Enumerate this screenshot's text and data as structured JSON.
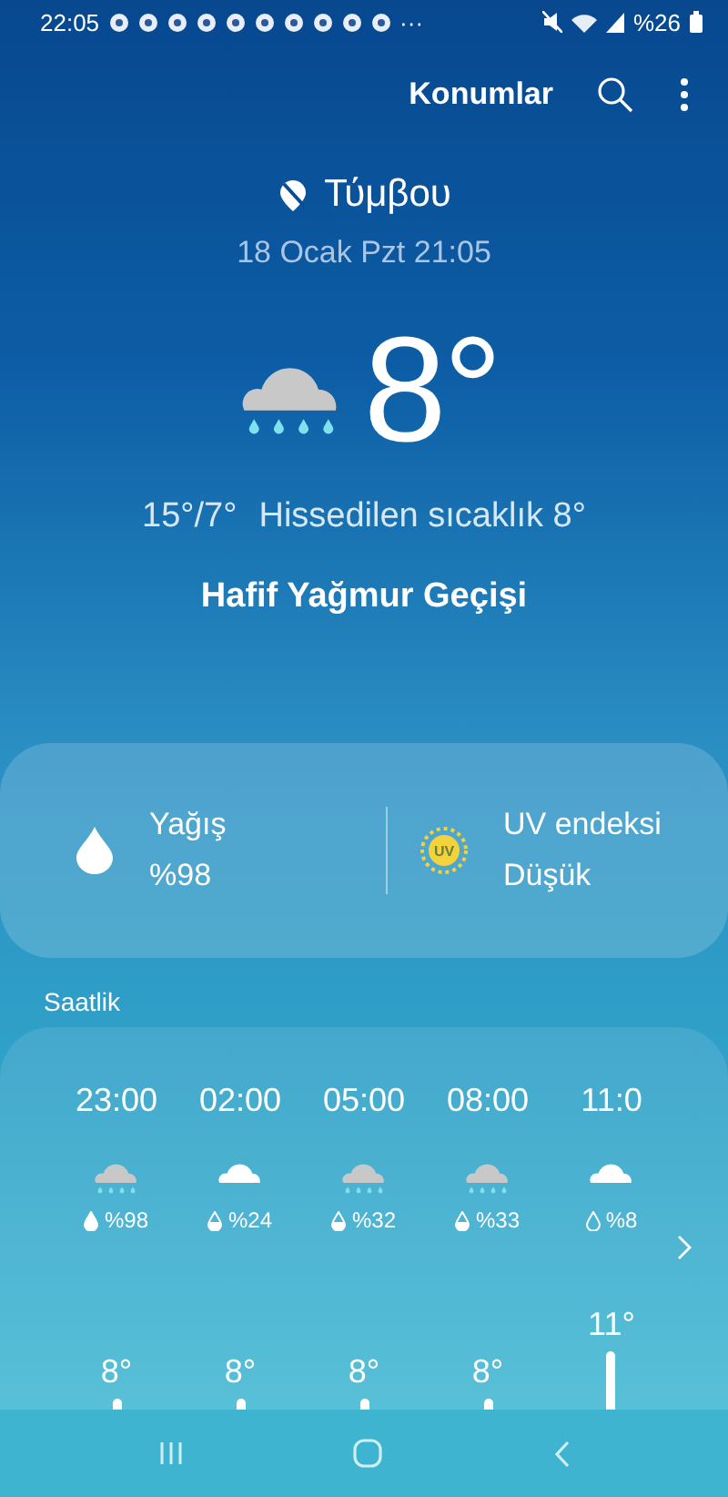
{
  "status_bar": {
    "time": "22:05",
    "overflow": "···",
    "battery_text": "%26"
  },
  "app_bar": {
    "locations_button": "Konumlar"
  },
  "location": {
    "name": "Τύμβου",
    "updated": "18 Ocak Pzt 21:05"
  },
  "current": {
    "kind": "rain",
    "temperature": "8°",
    "high_low": "15°/7°",
    "feels_like": "Hissedilen sıcaklık 8°",
    "condition": "Hafif Yağmur Geçişi"
  },
  "details": [
    {
      "kind": "precipitation",
      "label": "Yağış",
      "value": "%98"
    },
    {
      "kind": "uv",
      "label": "UV endeksi",
      "value": "Düşük",
      "badge": "UV"
    }
  ],
  "hourly": {
    "title": "Saatlik",
    "items": [
      {
        "time": "23:00",
        "kind": "rain",
        "precipitation": "%98",
        "temperature": "8°"
      },
      {
        "time": "02:00",
        "kind": "cloud",
        "precipitation": "%24",
        "temperature": "8°"
      },
      {
        "time": "05:00",
        "kind": "rain",
        "precipitation": "%32",
        "temperature": "8°"
      },
      {
        "time": "08:00",
        "kind": "rain",
        "precipitation": "%33",
        "temperature": "8°"
      },
      {
        "time": "11:0",
        "kind": "cloud",
        "precipitation": "%8",
        "temperature": "11°"
      }
    ]
  }
}
